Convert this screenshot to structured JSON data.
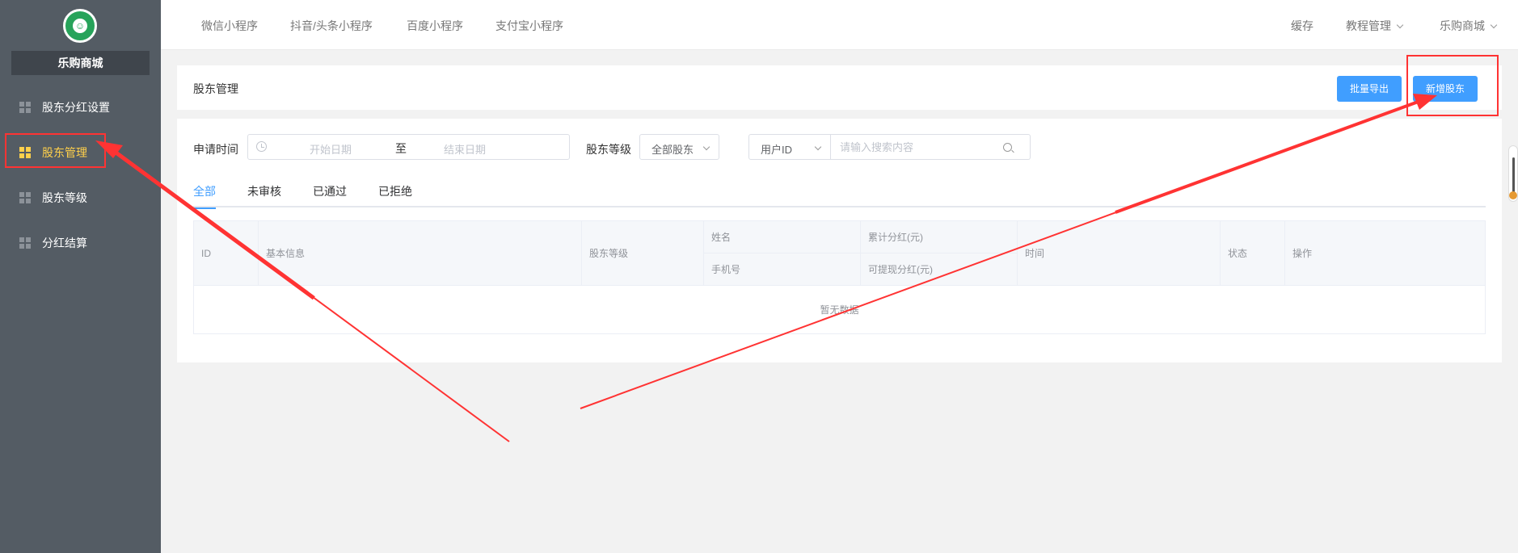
{
  "sidebar": {
    "logo_icon": "store-logo",
    "store_name": "乐购商城",
    "items": [
      {
        "label": "股东分红设置",
        "active": false
      },
      {
        "label": "股东管理",
        "active": true
      },
      {
        "label": "股东等级",
        "active": false
      },
      {
        "label": "分红结算",
        "active": false
      }
    ],
    "active_color": "#ffd04b",
    "background": "#545c64"
  },
  "topnav": {
    "items": [
      "微信小程序",
      "抖音/头条小程序",
      "百度小程序",
      "支付宝小程序"
    ],
    "right": {
      "cache": "缓存",
      "tutorial": "教程管理",
      "store": "乐购商城"
    }
  },
  "header": {
    "title": "股东管理",
    "export_button": "批量导出",
    "add_button": "新增股东"
  },
  "filters": {
    "apply_time_label": "申请时间",
    "start_placeholder": "开始日期",
    "range_separator": "至",
    "end_placeholder": "结束日期",
    "level_label": "股东等级",
    "level_value": "全部股东",
    "field_value": "用户ID",
    "search_placeholder": "请输入搜索内容"
  },
  "tabs": [
    "全部",
    "未审核",
    "已通过",
    "已拒绝"
  ],
  "table": {
    "columns": {
      "id": "ID",
      "basic_info": "基本信息",
      "level": "股东等级",
      "name": "姓名",
      "phone": "手机号",
      "total_dividend": "累计分红(元)",
      "withdrawable_dividend": "可提现分红(元)",
      "time": "时间",
      "status": "状态",
      "actions": "操作"
    },
    "empty_text": "暂无数据"
  },
  "colors": {
    "primary": "#409eff",
    "annotation": "#ff3333"
  }
}
